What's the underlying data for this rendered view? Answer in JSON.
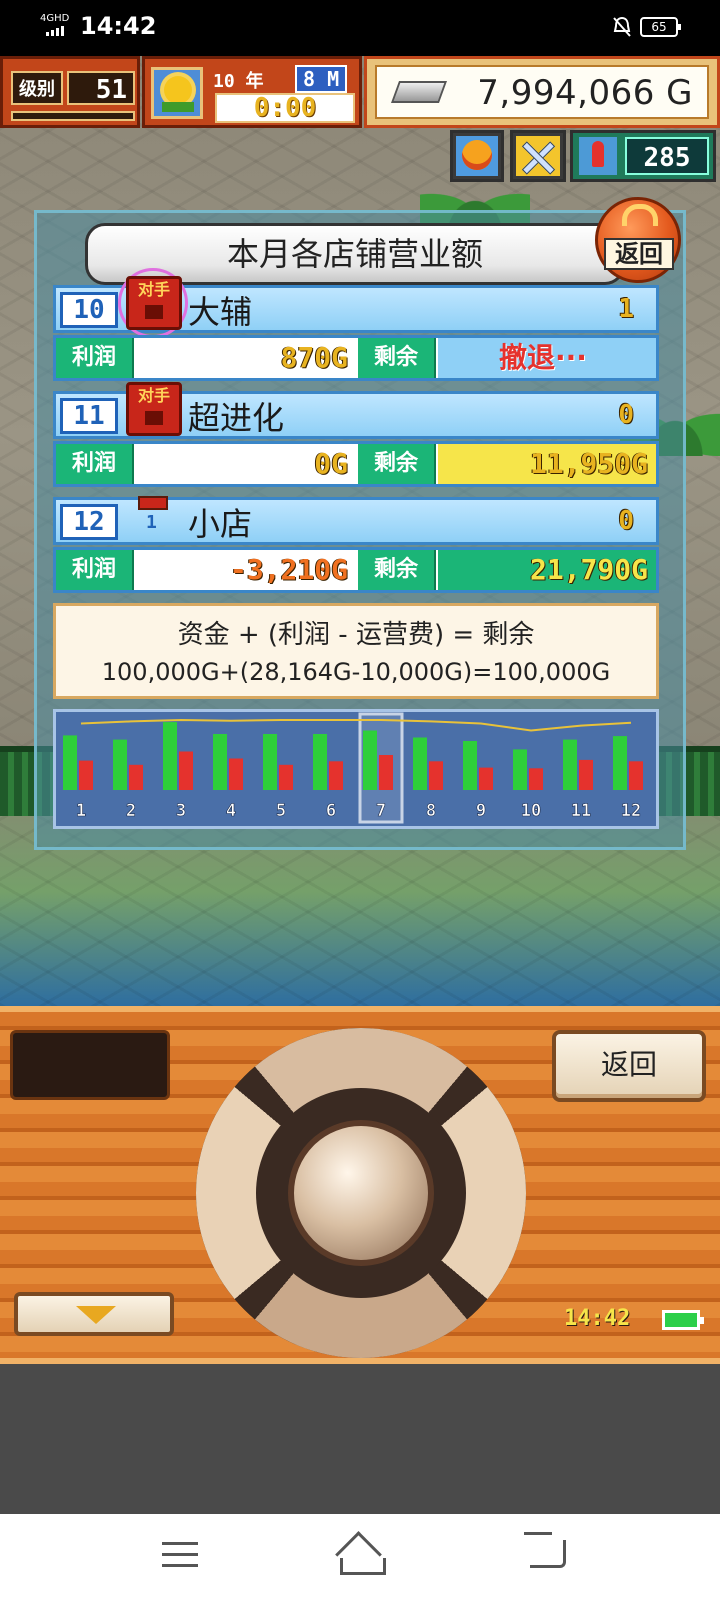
{
  "status_bar": {
    "network": "4GHD",
    "time": "14:42",
    "battery": "65"
  },
  "hud": {
    "level_label": "级别",
    "level": "51",
    "year": "10 年",
    "month": "8 M",
    "clock": "0:00",
    "money": "7,994,066 G",
    "stamina": "285"
  },
  "panel": {
    "title": "本月各店铺营业额",
    "back_label": "返回",
    "profit_label": "利润",
    "remain_label": "剩余",
    "rival_label": "对手",
    "stores": [
      {
        "rank": "10",
        "name": "大辅",
        "count": "1",
        "profit": "870G",
        "remain": "撤退···",
        "rival": true
      },
      {
        "rank": "11",
        "name": "超进化",
        "count": "0",
        "profit": "0G",
        "remain": "11,950G",
        "rival": true
      },
      {
        "rank": "12",
        "name": "小店",
        "count": "0",
        "profit": "-3,210G",
        "remain": "21,790G",
        "rival": false,
        "shop_level": "1"
      }
    ],
    "formula_line1": "资金 + (利润 - 运营费) = 剩余",
    "formula_line2": "100,000G+(28,164G-10,000G)=100,000G"
  },
  "chart_data": {
    "type": "bar",
    "categories": [
      "1",
      "2",
      "3",
      "4",
      "5",
      "6",
      "7",
      "8",
      "9",
      "10",
      "11",
      "12"
    ],
    "series": [
      {
        "values": [
          0.78,
          0.72,
          0.97,
          0.8,
          0.8,
          0.8,
          0.85,
          0.75,
          0.7,
          0.58,
          0.72,
          0.77
        ]
      },
      {
        "values": [
          0.42,
          0.36,
          0.55,
          0.45,
          0.36,
          0.41,
          0.5,
          0.41,
          0.32,
          0.31,
          0.43,
          0.41
        ]
      }
    ],
    "line": [
      0.95,
      0.98,
      1.0,
      0.99,
      1.0,
      1.0,
      1.0,
      0.98,
      0.95,
      0.85,
      0.92,
      0.96
    ],
    "selected": "7",
    "colors": {
      "profit": "#2ecf3a",
      "expense": "#e5322d",
      "line": "#e8c23a"
    }
  },
  "controller": {
    "back_label": "返回",
    "clock": "14:42"
  }
}
